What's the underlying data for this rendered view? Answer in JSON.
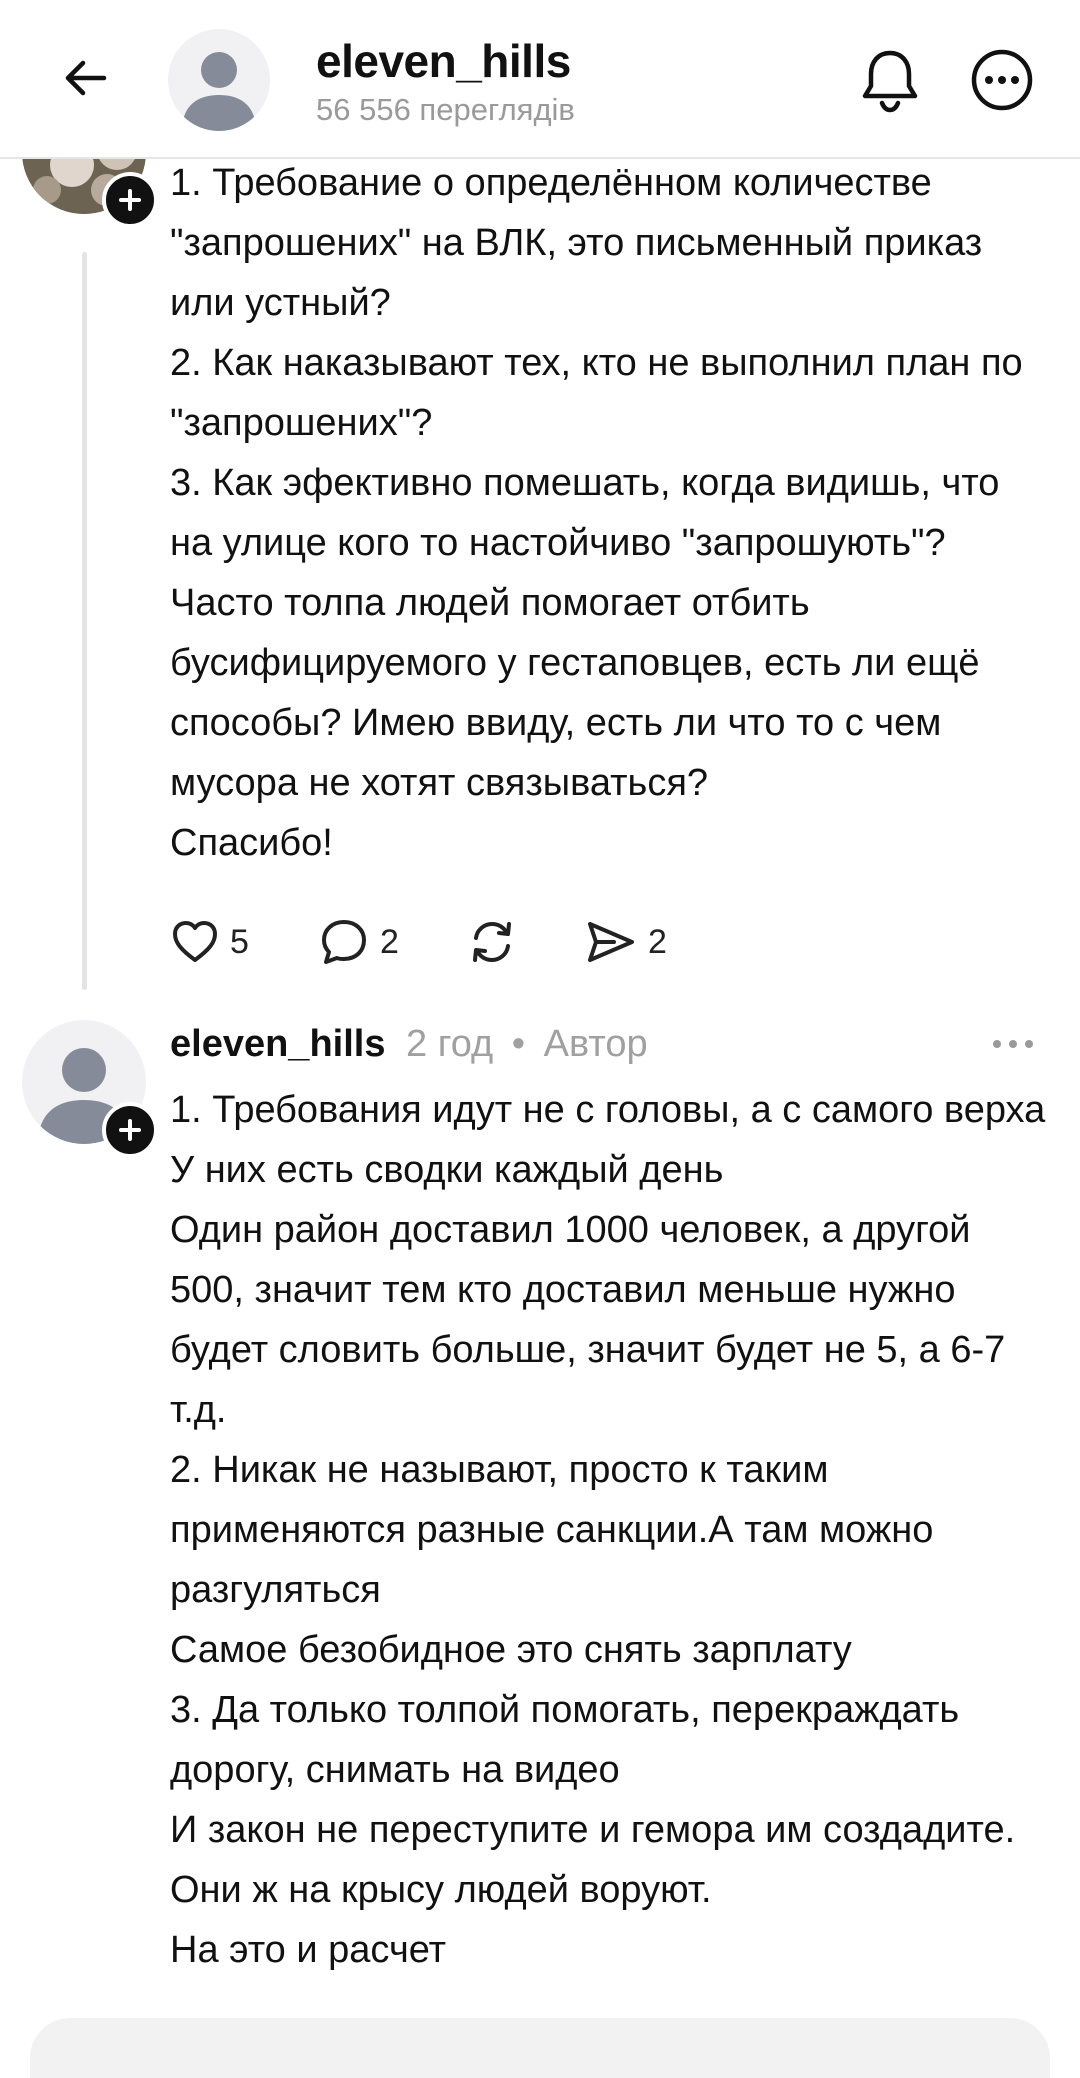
{
  "header": {
    "username": "eleven_hills",
    "views": "56 556 переглядів",
    "icons": {
      "back": "arrow-left-icon",
      "notifications": "bell-icon",
      "more": "more-circle-icon"
    }
  },
  "posts": [
    {
      "avatar": "photo-avatar",
      "text": "1. Требование о определённом количестве \"запрошених\" на ВЛК, это письменный приказ или устный?\n2. Как наказывают тех, кто не выполнил план по \"запрошених\"?\n3. Как эфективно помешать, когда видишь, что на улице кого то настойчиво \"запрошують\"? Часто толпа людей помогает отбить бусифицируемого у гестаповцев, есть ли ещё способы? Имею ввиду, есть ли что то с чем мусора не хотят связываться?\nСпасибо!",
      "actions": {
        "likes": "5",
        "replies": "2",
        "shares": "2"
      }
    },
    {
      "username": "eleven_hills",
      "time": "2 год",
      "separator": "•",
      "author_label": "Автор",
      "text": "1. Требования идут не с головы, а с самого верха\nУ них есть сводки каждый день\nОдин район доставил 1000 человек, а другой 500, значит тем кто доставил меньше нужно будет словить больше, значит будет не 5, а 6-7 т.д.\n2. Никак не называют, просто к таким применяются разные санкции.А там можно разгуляться\nСамое безобидное это снять зарплату\n3. Да только толпой помогать, перекраждать дорогу, снимать на видео\nИ закон не переступите и гемора им создадите. Они ж на крысу людей воруют.\nНа это и расчет"
    }
  ]
}
